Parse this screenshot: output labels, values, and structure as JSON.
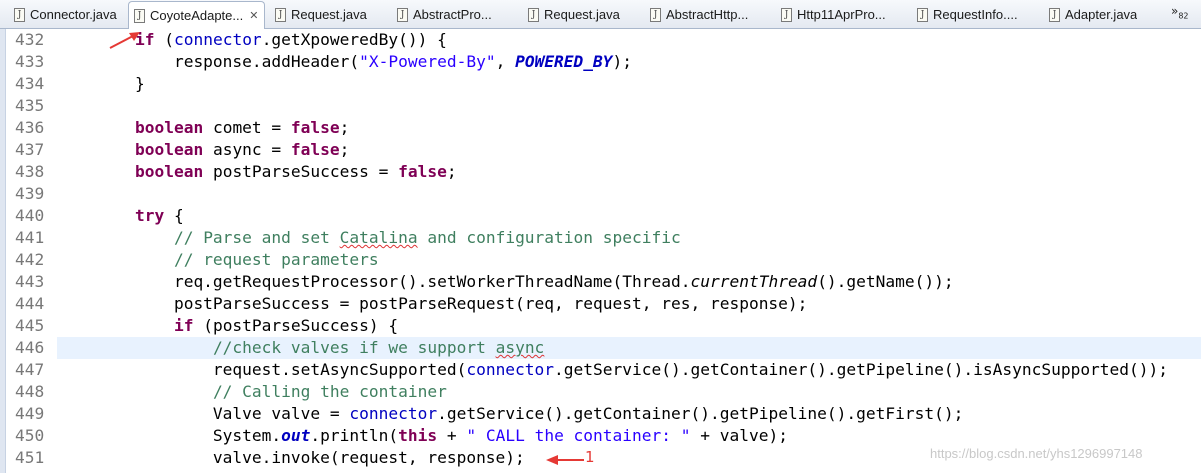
{
  "tabs": [
    {
      "label": "Connector.java",
      "active": false
    },
    {
      "label": "CoyoteAdapte...",
      "active": true,
      "close": "✕"
    },
    {
      "label": "Request.java",
      "active": false
    },
    {
      "label": "AbstractPro...",
      "active": false
    },
    {
      "label": "Request.java",
      "active": false
    },
    {
      "label": "AbstractHttp...",
      "active": false
    },
    {
      "label": "Http11AprPro...",
      "active": false
    },
    {
      "label": "RequestInfo....",
      "active": false
    },
    {
      "label": "Adapter.java",
      "active": false
    }
  ],
  "tab_overflow": {
    "symbol": "»",
    "count": "82"
  },
  "code_lines": [
    {
      "num": "432",
      "segments": [
        {
          "t": "        "
        },
        {
          "t": "if",
          "c": "kw"
        },
        {
          "t": " ("
        },
        {
          "t": "connector",
          "c": "fld"
        },
        {
          "t": ".getXpoweredBy()) {"
        }
      ]
    },
    {
      "num": "433",
      "segments": [
        {
          "t": "            response.addHeader("
        },
        {
          "t": "\"X-Powered-By\"",
          "c": "str"
        },
        {
          "t": ", "
        },
        {
          "t": "POWERED_BY",
          "c": "sfld"
        },
        {
          "t": ");"
        }
      ]
    },
    {
      "num": "434",
      "segments": [
        {
          "t": "        }"
        }
      ]
    },
    {
      "num": "435",
      "segments": []
    },
    {
      "num": "436",
      "segments": [
        {
          "t": "        "
        },
        {
          "t": "boolean",
          "c": "kw"
        },
        {
          "t": " comet = "
        },
        {
          "t": "false",
          "c": "kw"
        },
        {
          "t": ";"
        }
      ]
    },
    {
      "num": "437",
      "segments": [
        {
          "t": "        "
        },
        {
          "t": "boolean",
          "c": "kw"
        },
        {
          "t": " async = "
        },
        {
          "t": "false",
          "c": "kw"
        },
        {
          "t": ";"
        }
      ]
    },
    {
      "num": "438",
      "segments": [
        {
          "t": "        "
        },
        {
          "t": "boolean",
          "c": "kw"
        },
        {
          "t": " postParseSuccess = "
        },
        {
          "t": "false",
          "c": "kw"
        },
        {
          "t": ";"
        }
      ]
    },
    {
      "num": "439",
      "segments": []
    },
    {
      "num": "440",
      "segments": [
        {
          "t": "        "
        },
        {
          "t": "try",
          "c": "kw"
        },
        {
          "t": " {"
        }
      ]
    },
    {
      "num": "441",
      "segments": [
        {
          "t": "            "
        },
        {
          "t": "// Parse and set ",
          "c": "cmt"
        },
        {
          "t": "Catalina",
          "c": "cmt sq"
        },
        {
          "t": " and configuration specific",
          "c": "cmt"
        }
      ]
    },
    {
      "num": "442",
      "segments": [
        {
          "t": "            "
        },
        {
          "t": "// request parameters",
          "c": "cmt"
        }
      ]
    },
    {
      "num": "443",
      "segments": [
        {
          "t": "            req.getRequestProcessor().setWorkerThreadName(Thread."
        },
        {
          "t": "currentThread",
          "c": "ital"
        },
        {
          "t": "().getName());"
        }
      ]
    },
    {
      "num": "444",
      "segments": [
        {
          "t": "            postParseSuccess = postParseRequest(req, request, res, response);"
        }
      ]
    },
    {
      "num": "445",
      "segments": [
        {
          "t": "            "
        },
        {
          "t": "if",
          "c": "kw"
        },
        {
          "t": " (postParseSuccess) {"
        }
      ]
    },
    {
      "num": "446",
      "highlight": true,
      "segments": [
        {
          "t": "                "
        },
        {
          "t": "//check valves if we support ",
          "c": "cmt"
        },
        {
          "t": "async",
          "c": "cmt sq"
        }
      ]
    },
    {
      "num": "447",
      "segments": [
        {
          "t": "                request.setAsyncSupported("
        },
        {
          "t": "connector",
          "c": "fld"
        },
        {
          "t": ".getService().getContainer().getPipeline().isAsyncSupported());"
        }
      ]
    },
    {
      "num": "448",
      "segments": [
        {
          "t": "                "
        },
        {
          "t": "// Calling the container",
          "c": "cmt"
        }
      ]
    },
    {
      "num": "449",
      "segments": [
        {
          "t": "                Valve valve = "
        },
        {
          "t": "connector",
          "c": "fld"
        },
        {
          "t": ".getService().getContainer().getPipeline().getFirst();"
        }
      ]
    },
    {
      "num": "450",
      "segments": [
        {
          "t": "                System."
        },
        {
          "t": "out",
          "c": "sfld"
        },
        {
          "t": ".println("
        },
        {
          "t": "this",
          "c": "kw"
        },
        {
          "t": " + "
        },
        {
          "t": "\" CALL the container: \"",
          "c": "str"
        },
        {
          "t": " + valve);"
        }
      ]
    },
    {
      "num": "451",
      "segments": [
        {
          "t": "                valve.invoke(request, response);"
        }
      ]
    }
  ],
  "annotation": {
    "label": "1",
    "color": "#e53935"
  },
  "watermark": "https://blog.csdn.net/yhs1296997148"
}
